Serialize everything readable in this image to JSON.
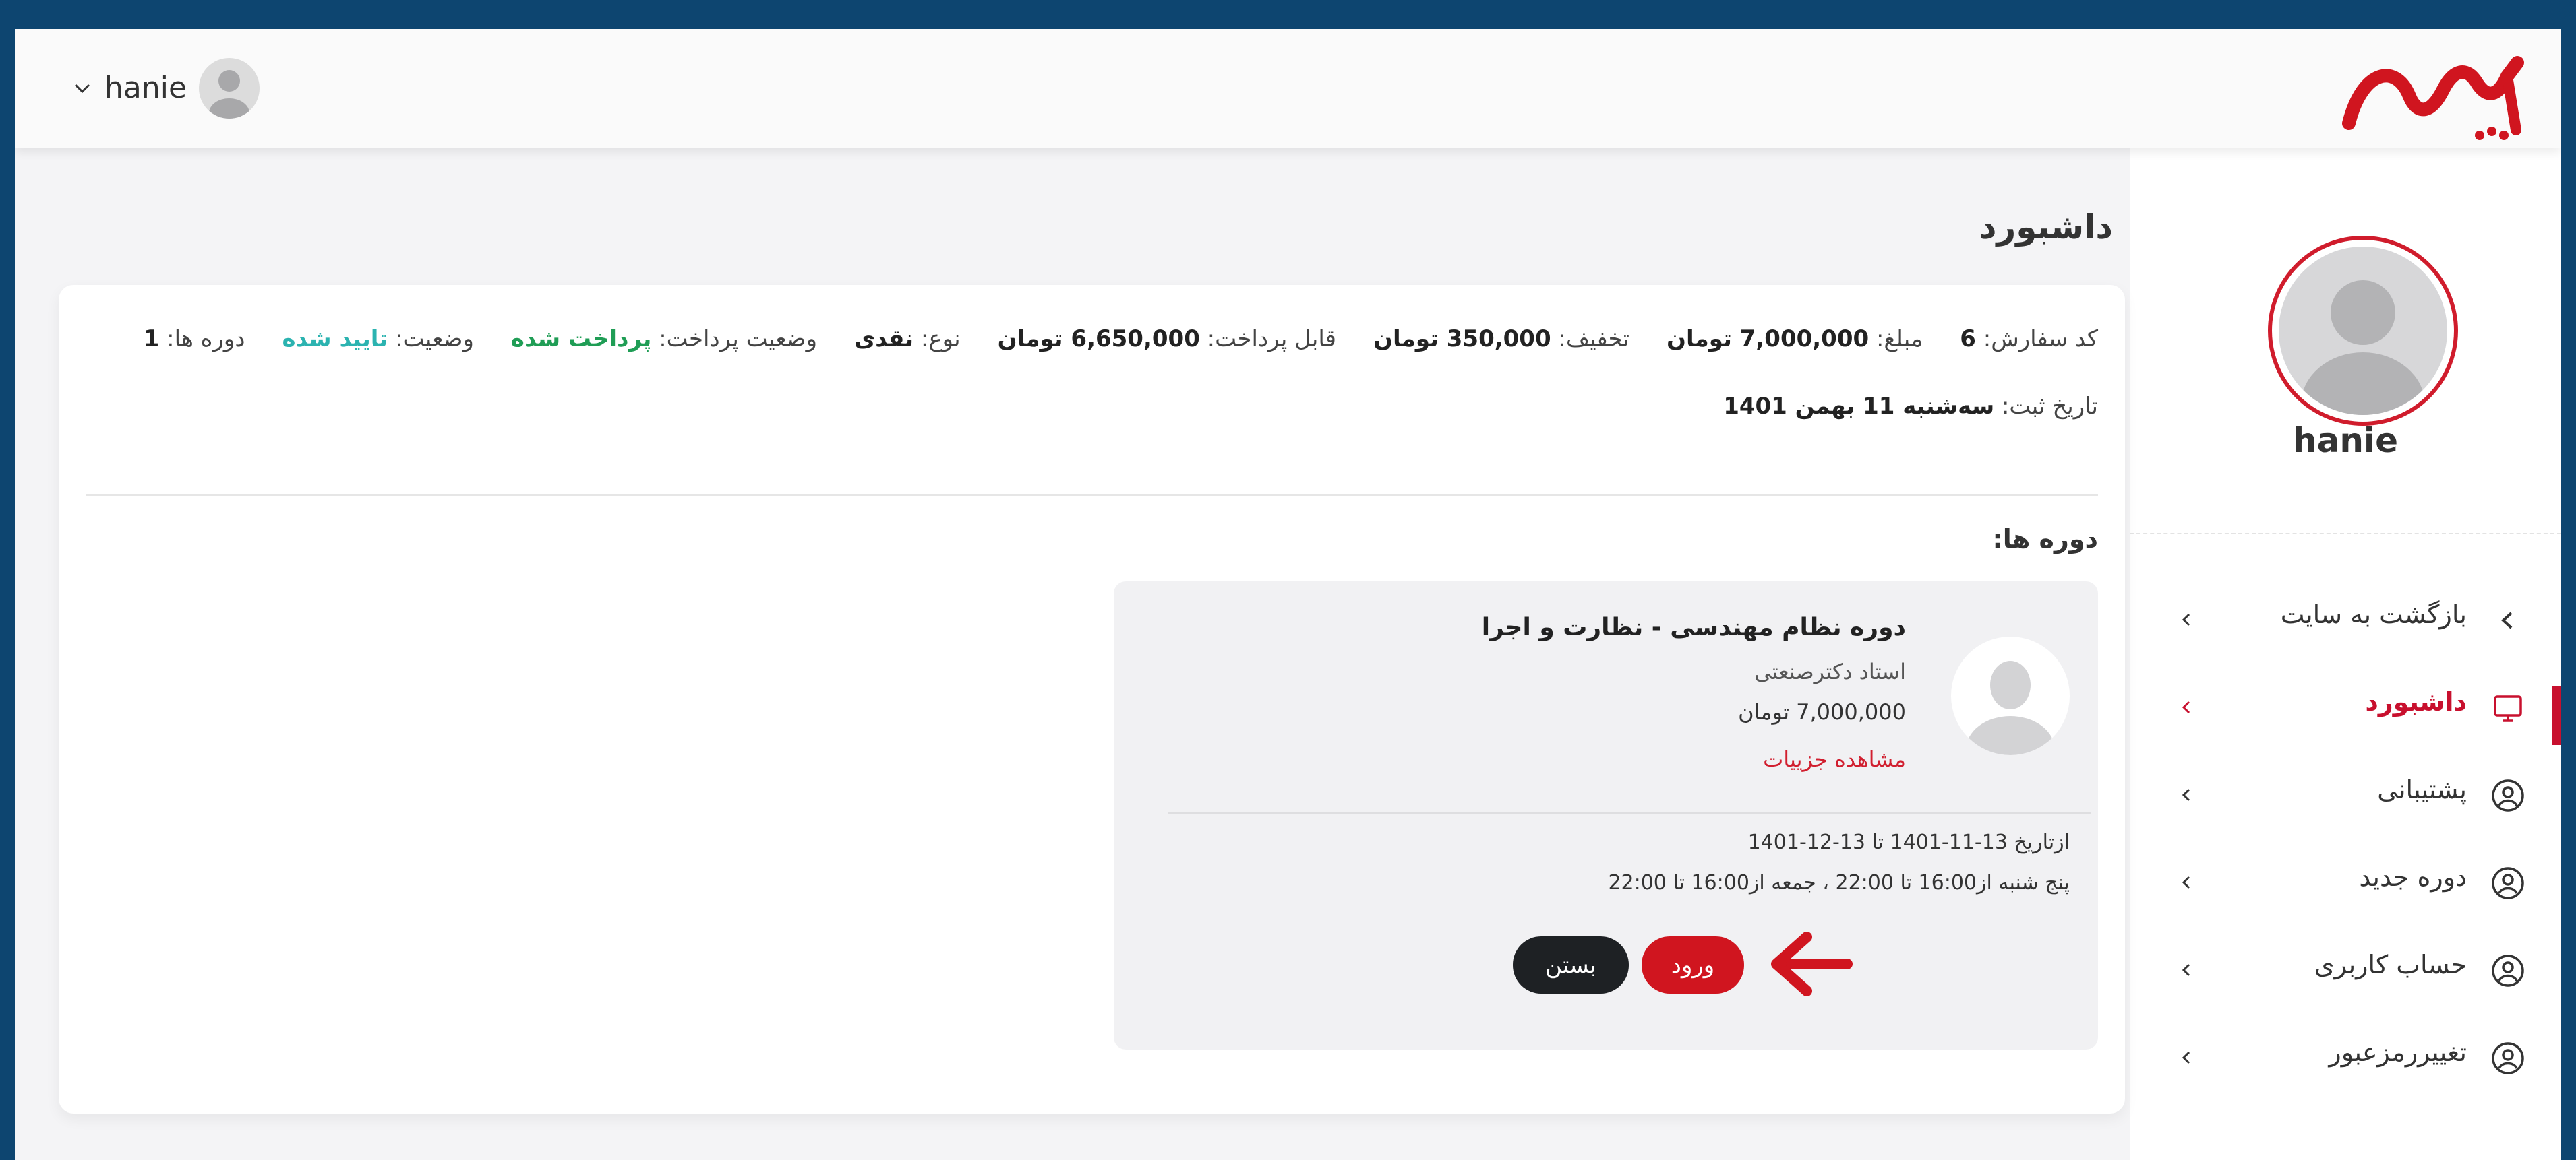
{
  "header": {
    "user": "hanie",
    "logo_text": "پارسه"
  },
  "sidebar": {
    "profile_name": "hanie",
    "items": [
      {
        "label": "بازگشت به سایت",
        "icon": "chevron-left-icon"
      },
      {
        "label": "داشبورد",
        "icon": "monitor-icon",
        "active": true
      },
      {
        "label": "پشتیبانی",
        "icon": "user-circle-icon"
      },
      {
        "label": "دوره جدید",
        "icon": "user-circle-icon"
      },
      {
        "label": "حساب کاربری",
        "icon": "user-circle-icon"
      },
      {
        "label": "تغییررمزعبور",
        "icon": "user-circle-icon"
      }
    ]
  },
  "main": {
    "title": "داشبورد",
    "order": {
      "code_label": "کد سفارش:",
      "code": "6",
      "amount_label": "مبلغ:",
      "amount": "7,000,000 تومان",
      "discount_label": "تخفیف:",
      "discount": "350,000 تومان",
      "payable_label": "قابل پرداخت:",
      "payable": "6,650,000 تومان",
      "type_label": "نوع:",
      "type": "نقدی",
      "payment_status_label": "وضعیت پرداخت:",
      "payment_status": "پرداخت شده",
      "status_label": "وضعیت:",
      "status": "تایید شده",
      "courses_count_label": "دوره ها:",
      "courses_count": "1",
      "date_label": "تاریخ ثبت:",
      "date": "سه‌شنبه 11 بهمن 1401"
    },
    "courses_label": "دوره ها:",
    "course": {
      "title": "دوره نظام مهندسی - نظارت و اجرا",
      "teacher": "استاد دکترصنعتی",
      "price": "7,000,000 تومان",
      "details_link": "مشاهده جزییات",
      "dates": "ازتاریخ 13-11-1401 تا 13-12-1401",
      "schedule": "پنج شنبه از16:00 تا 22:00 ، جمعه از16:00 تا 22:00",
      "enter_button": "ورود",
      "close_button": "بستن"
    }
  },
  "colors": {
    "brand_red": "#c8102e",
    "frame_blue": "#0d4570",
    "green": "#1f9d55",
    "teal": "#2bb3b0"
  }
}
